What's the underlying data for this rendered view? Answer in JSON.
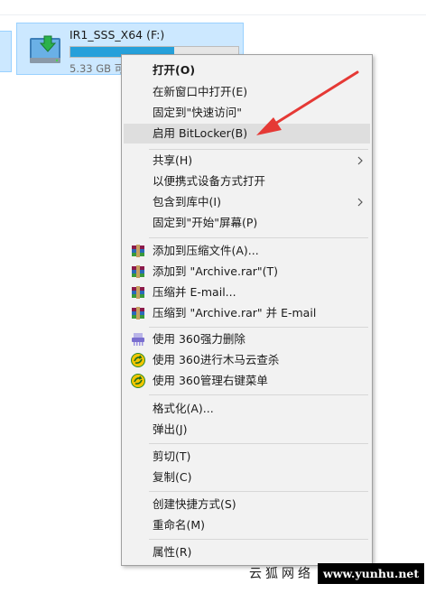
{
  "drive": {
    "name": "IR1_SSS_X64 (F:)",
    "free_text": "5.33 GB 可",
    "usage_fraction": 0.62,
    "bar_color": "#26a0da",
    "icon": "drive-install-icon"
  },
  "menu": {
    "open": "打开(O)",
    "open_new_window": "在新窗口中打开(E)",
    "pin_quick_access": "固定到\"快速访问\"",
    "bitlocker": "启用 BitLocker(B)",
    "share": "共享(H)",
    "open_portable": "以便携式设备方式打开",
    "include_library": "包含到库中(I)",
    "pin_start": "固定到\"开始\"屏幕(P)",
    "add_archive": "添加到压缩文件(A)...",
    "add_archive_rar": "添加到 \"Archive.rar\"(T)",
    "compress_email": "压缩并 E-mail...",
    "compress_rar_email": "压缩到 \"Archive.rar\" 并 E-mail",
    "force_delete_360": "使用 360强力删除",
    "trojan_scan_360": "使用 360进行木马云查杀",
    "manage_menu_360": "使用 360管理右键菜单",
    "format": "格式化(A)...",
    "eject": "弹出(J)",
    "cut": "剪切(T)",
    "copy": "复制(C)",
    "create_shortcut": "创建快捷方式(S)",
    "rename": "重命名(M)",
    "properties": "属性(R)"
  },
  "watermark": {
    "name": "云狐网络",
    "url": "www.yunhu.net"
  },
  "colors": {
    "selection_fill": "#cce8ff",
    "menu_highlight": "#dedede",
    "annotation_arrow": "#e53935"
  }
}
